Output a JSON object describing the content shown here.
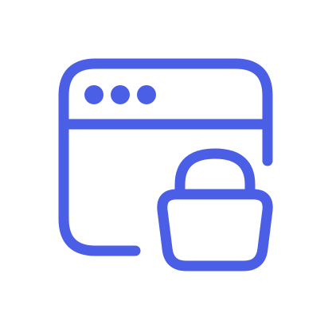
{
  "icon": {
    "name": "browser-lock-icon",
    "stroke_color": "#4A5FE6",
    "background_color": "#FFFFFF",
    "parts": [
      "browser-window-icon",
      "window-dot-icon",
      "padlock-icon"
    ]
  }
}
